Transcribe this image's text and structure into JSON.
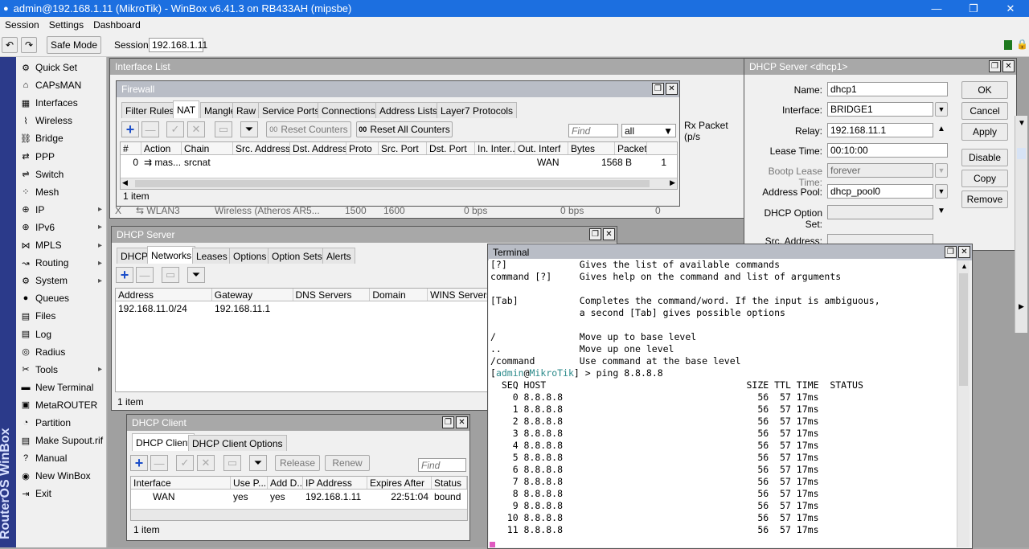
{
  "window": {
    "title": "admin@192.168.1.11 (MikroTik) - WinBox v6.41.3 on RB433AH (mipsbe)"
  },
  "menu": [
    "Session",
    "Settings",
    "Dashboard"
  ],
  "toolbar": {
    "safe_mode": "Safe Mode",
    "session_label": "Session:",
    "session_value": "192.168.1.11"
  },
  "brand": "RouterOS WinBox",
  "sidebar": [
    {
      "label": "Quick Set",
      "icon": "quick-set-icon",
      "sub": false
    },
    {
      "label": "CAPsMAN",
      "icon": "capsman-icon",
      "sub": false
    },
    {
      "label": "Interfaces",
      "icon": "interfaces-icon",
      "sub": false
    },
    {
      "label": "Wireless",
      "icon": "wireless-icon",
      "sub": false
    },
    {
      "label": "Bridge",
      "icon": "bridge-icon",
      "sub": false
    },
    {
      "label": "PPP",
      "icon": "ppp-icon",
      "sub": false
    },
    {
      "label": "Switch",
      "icon": "switch-icon",
      "sub": false
    },
    {
      "label": "Mesh",
      "icon": "mesh-icon",
      "sub": false
    },
    {
      "label": "IP",
      "icon": "ip-icon",
      "sub": true
    },
    {
      "label": "IPv6",
      "icon": "ipv6-icon",
      "sub": true
    },
    {
      "label": "MPLS",
      "icon": "mpls-icon",
      "sub": true
    },
    {
      "label": "Routing",
      "icon": "routing-icon",
      "sub": true
    },
    {
      "label": "System",
      "icon": "system-icon",
      "sub": true
    },
    {
      "label": "Queues",
      "icon": "queues-icon",
      "sub": false
    },
    {
      "label": "Files",
      "icon": "files-icon",
      "sub": false
    },
    {
      "label": "Log",
      "icon": "log-icon",
      "sub": false
    },
    {
      "label": "Radius",
      "icon": "radius-icon",
      "sub": false
    },
    {
      "label": "Tools",
      "icon": "tools-icon",
      "sub": true
    },
    {
      "label": "New Terminal",
      "icon": "terminal-icon",
      "sub": false
    },
    {
      "label": "MetaROUTER",
      "icon": "metarouter-icon",
      "sub": false
    },
    {
      "label": "Partition",
      "icon": "partition-icon",
      "sub": false
    },
    {
      "label": "Make Supout.rif",
      "icon": "supout-icon",
      "sub": false
    },
    {
      "label": "Manual",
      "icon": "manual-icon",
      "sub": false
    },
    {
      "label": "New WinBox",
      "icon": "winbox-icon",
      "sub": false
    },
    {
      "label": "Exit",
      "icon": "exit-icon",
      "sub": false
    }
  ],
  "interface_list": {
    "title": "Interface List",
    "rx_col": "Rx Packet (p/s",
    "row": {
      "flag": "X",
      "name": "WLAN3",
      "type": "Wireless (Atheros AR5...",
      "mtu": "1500",
      "l2mtu": "1600",
      "tx": "0 bps",
      "rx": "0 bps",
      "pkt": "0"
    }
  },
  "firewall": {
    "title": "Firewall",
    "tabs": [
      "Filter Rules",
      "NAT",
      "Mangle",
      "Raw",
      "Service Ports",
      "Connections",
      "Address Lists",
      "Layer7 Protocols"
    ],
    "reset_counters": "Reset Counters",
    "reset_all_counters": "Reset All Counters",
    "find_placeholder": "Find",
    "filter_value": "all",
    "columns": [
      "#",
      "Action",
      "Chain",
      "Src. Address",
      "Dst. Address",
      "Proto",
      "Src. Port",
      "Dst. Port",
      "In. Inter...",
      "Out. Interf",
      "Bytes",
      "Packet"
    ],
    "row": {
      "num": "0",
      "action": "mas...",
      "chain": "srcnat",
      "out": "WAN",
      "bytes": "1568 B",
      "packets": "1"
    },
    "footer": "1 item"
  },
  "dhcp_server": {
    "title": "DHCP Server",
    "tabs": [
      "DHCP",
      "Networks",
      "Leases",
      "Options",
      "Option Sets",
      "Alerts"
    ],
    "columns": [
      "Address",
      "Gateway",
      "DNS Servers",
      "Domain",
      "WINS Servers"
    ],
    "row": {
      "address": "192.168.11.0/24",
      "gateway": "192.168.11.1"
    },
    "footer": "1 item"
  },
  "dhcp_client": {
    "title": "DHCP Client",
    "tabs": [
      "DHCP Client",
      "DHCP Client Options"
    ],
    "release": "Release",
    "renew": "Renew",
    "find_placeholder": "Find",
    "columns": [
      "Interface",
      "Use P...",
      "Add D...",
      "IP Address",
      "Expires After",
      "Status"
    ],
    "row": {
      "interface": "WAN",
      "use_peer": "yes",
      "add_default": "yes",
      "ip": "192.168.1.11",
      "expires": "22:51:04",
      "status": "bound"
    },
    "footer": "1 item"
  },
  "dhcp_server_dialog": {
    "title": "DHCP Server <dhcp1>",
    "fields": {
      "name_label": "Name:",
      "name_value": "dhcp1",
      "interface_label": "Interface:",
      "interface_value": "BRIDGE1",
      "relay_label": "Relay:",
      "relay_value": "192.168.11.1",
      "lease_label": "Lease Time:",
      "lease_value": "00:10:00",
      "bootp_label": "Bootp Lease Time:",
      "bootp_value": "forever",
      "pool_label": "Address Pool:",
      "pool_value": "dhcp_pool0",
      "option_set_label": "DHCP Option Set:",
      "src_label": "Src. Address:"
    },
    "buttons": {
      "ok": "OK",
      "cancel": "Cancel",
      "apply": "Apply",
      "disable": "Disable",
      "copy": "Copy",
      "remove": "Remove"
    }
  },
  "terminal": {
    "title": "Terminal",
    "help": [
      {
        "cmd": "[?]",
        "desc": "Gives the list of available commands"
      },
      {
        "cmd": "command [?]",
        "desc": "Gives help on the command and list of arguments"
      },
      {
        "cmd": "",
        "desc": ""
      },
      {
        "cmd": "[Tab]",
        "desc": "Completes the command/word. If the input is ambiguous,"
      },
      {
        "cmd": "",
        "desc": "a second [Tab] gives possible options"
      },
      {
        "cmd": "",
        "desc": ""
      },
      {
        "cmd": "/",
        "desc": "Move up to base level"
      },
      {
        "cmd": "..",
        "desc": "Move up one level"
      },
      {
        "cmd": "/command",
        "desc": "Use command at the base level"
      }
    ],
    "prompt_user": "admin",
    "prompt_host": "MikroTik",
    "command": "ping 8.8.8.8",
    "ping_header": {
      "seq": "SEQ",
      "host": "HOST",
      "size": "SIZE",
      "ttl": "TTL",
      "time": "TIME",
      "status": "STATUS"
    },
    "ping_rows": [
      {
        "seq": "0",
        "host": "8.8.8.8",
        "size": "56",
        "ttl": "57",
        "time": "17ms"
      },
      {
        "seq": "1",
        "host": "8.8.8.8",
        "size": "56",
        "ttl": "57",
        "time": "17ms"
      },
      {
        "seq": "2",
        "host": "8.8.8.8",
        "size": "56",
        "ttl": "57",
        "time": "17ms"
      },
      {
        "seq": "3",
        "host": "8.8.8.8",
        "size": "56",
        "ttl": "57",
        "time": "17ms"
      },
      {
        "seq": "4",
        "host": "8.8.8.8",
        "size": "56",
        "ttl": "57",
        "time": "17ms"
      },
      {
        "seq": "5",
        "host": "8.8.8.8",
        "size": "56",
        "ttl": "57",
        "time": "17ms"
      },
      {
        "seq": "6",
        "host": "8.8.8.8",
        "size": "56",
        "ttl": "57",
        "time": "17ms"
      },
      {
        "seq": "7",
        "host": "8.8.8.8",
        "size": "56",
        "ttl": "57",
        "time": "17ms"
      },
      {
        "seq": "8",
        "host": "8.8.8.8",
        "size": "56",
        "ttl": "57",
        "time": "17ms"
      },
      {
        "seq": "9",
        "host": "8.8.8.8",
        "size": "56",
        "ttl": "57",
        "time": "17ms"
      },
      {
        "seq": "10",
        "host": "8.8.8.8",
        "size": "56",
        "ttl": "57",
        "time": "17ms"
      },
      {
        "seq": "11",
        "host": "8.8.8.8",
        "size": "56",
        "ttl": "57",
        "time": "17ms"
      }
    ]
  },
  "colors": {
    "titlebar": "#1c6fe0",
    "brand": "#2b3a8a",
    "prompt": "#2a8a8a",
    "accent_blue": "#1b4ec9"
  }
}
